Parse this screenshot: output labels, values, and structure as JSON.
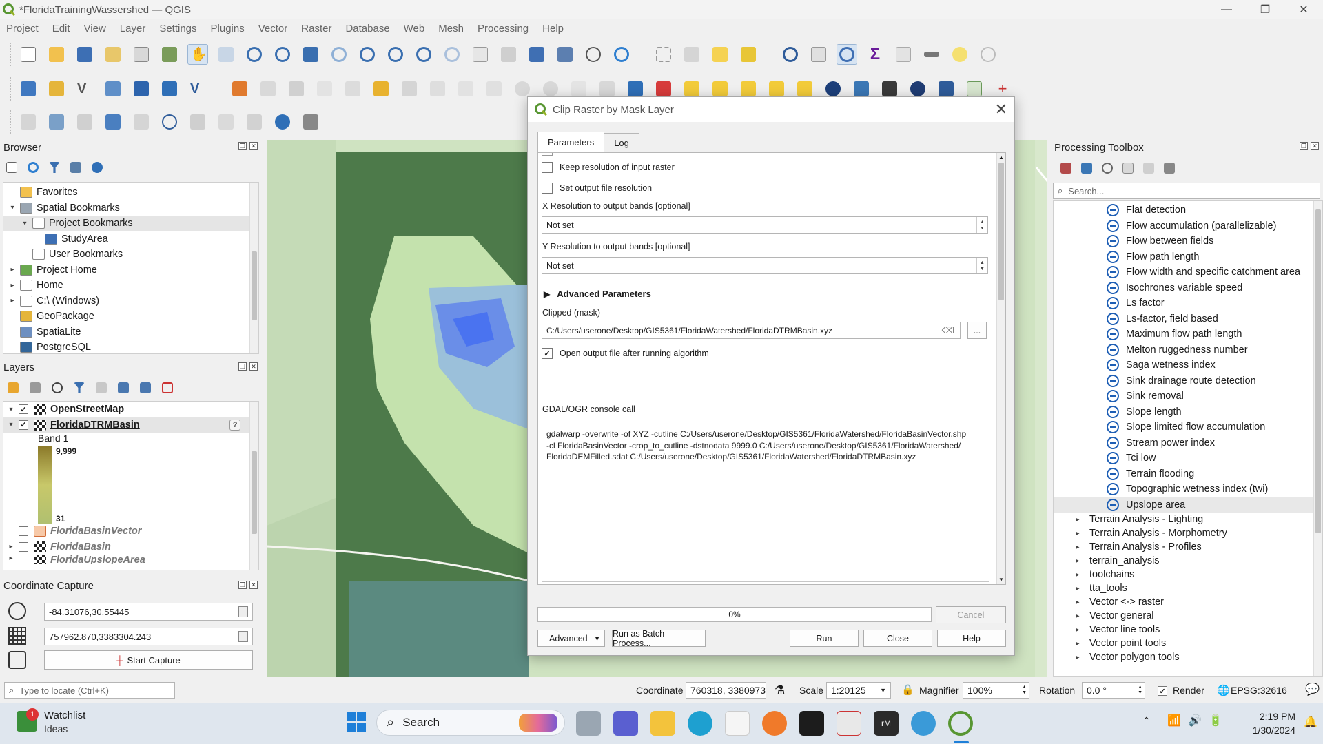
{
  "window": {
    "title": "*FloridaTrainingWassershed — QGIS"
  },
  "menu": [
    "Project",
    "Edit",
    "View",
    "Layer",
    "Settings",
    "Plugins",
    "Vector",
    "Raster",
    "Database",
    "Web",
    "Mesh",
    "Processing",
    "Help"
  ],
  "browser": {
    "title": "Browser",
    "items": [
      {
        "label": "Favorites",
        "depth": 0,
        "arrow": ""
      },
      {
        "label": "Spatial Bookmarks",
        "depth": 0,
        "arrow": "▾"
      },
      {
        "label": "Project Bookmarks",
        "depth": 1,
        "arrow": "▾"
      },
      {
        "label": "StudyArea",
        "depth": 2,
        "arrow": ""
      },
      {
        "label": "User Bookmarks",
        "depth": 1,
        "arrow": ""
      },
      {
        "label": "Project Home",
        "depth": 0,
        "arrow": "▸"
      },
      {
        "label": "Home",
        "depth": 0,
        "arrow": "▸"
      },
      {
        "label": "C:\\ (Windows)",
        "depth": 0,
        "arrow": "▸"
      },
      {
        "label": "GeoPackage",
        "depth": 0,
        "arrow": ""
      },
      {
        "label": "SpatiaLite",
        "depth": 0,
        "arrow": ""
      },
      {
        "label": "PostgreSQL",
        "depth": 0,
        "arrow": ""
      }
    ]
  },
  "layers": {
    "title": "Layers",
    "openstreetmap": "OpenStreetMap",
    "dtrm": "FloridaDTRMBasin",
    "band": "Band 1",
    "max": "9,999",
    "min": "31",
    "basin_vector": "FloridaBasinVector",
    "basin": "FloridaBasin",
    "upslope": "FloridaUpslopeArea"
  },
  "coordinate_capture": {
    "title": "Coordinate Capture",
    "geo": "-84.31076,30.55445",
    "proj": "757962.870,3383304.243",
    "start": "Start Capture"
  },
  "dialog": {
    "title": "Clip Raster by Mask Layer",
    "tab_parameters": "Parameters",
    "tab_log": "Log",
    "keep_resolution": "Keep resolution of input raster",
    "set_resolution": "Set output file resolution",
    "x_res_label": "X Resolution to output bands [optional]",
    "x_res_value": "Not set",
    "y_res_label": "Y Resolution to output bands [optional]",
    "y_res_value": "Not set",
    "advanced_params": "Advanced Parameters",
    "clipped_label": "Clipped (mask)",
    "clipped_path": "C:/Users/userone/Desktop/GIS5361/FloridaWatershed/FloridaDTRMBasin.xyz",
    "browse": "...",
    "open_output": "Open output file after running algorithm",
    "console_label": "GDAL/OGR console call",
    "console_lines": [
      "gdalwarp -overwrite -of XYZ -cutline C:/Users/userone/Desktop/GIS5361/FloridaWatershed/FloridaBasinVector.shp",
      "-cl FloridaBasinVector -crop_to_cutline -dstnodata 9999.0 C:/Users/userone/Desktop/GIS5361/FloridaWatershed/",
      "FloridaDEMFilled.sdat C:/Users/userone/Desktop/GIS5361/FloridaWatershed/FloridaDTRMBasin.xyz"
    ],
    "progress": "0%",
    "progress_value": 0,
    "cancel": "Cancel",
    "advanced": "Advanced",
    "batch": "Run as Batch Process...",
    "run": "Run",
    "close": "Close",
    "help": "Help"
  },
  "toolbox": {
    "title": "Processing Toolbox",
    "search_placeholder": "Search...",
    "algorithms": [
      "Flat detection",
      "Flow accumulation (parallelizable)",
      "Flow between fields",
      "Flow path length",
      "Flow width and specific catchment area",
      "Isochrones variable speed",
      "Ls factor",
      "Ls-factor, field based",
      "Maximum flow path length",
      "Melton ruggedness number",
      "Saga wetness index",
      "Sink drainage route detection",
      "Sink removal",
      "Slope length",
      "Slope limited flow accumulation",
      "Stream power index",
      "Tci low",
      "Terrain flooding",
      "Topographic wetness index (twi)",
      "Upslope area"
    ],
    "groups": [
      "Terrain Analysis - Lighting",
      "Terrain Analysis - Morphometry",
      "Terrain Analysis - Profiles",
      "terrain_analysis",
      "toolchains",
      "tta_tools",
      "Vector <-> raster",
      "Vector general",
      "Vector line tools",
      "Vector point tools",
      "Vector polygon tools"
    ]
  },
  "statusbar": {
    "locate_placeholder": "Type to locate (Ctrl+K)",
    "coordinate_label": "Coordinate",
    "coordinate": "760318, 3380973",
    "scale_label": "Scale",
    "scale": "1:20125",
    "magnifier_label": "Magnifier",
    "magnifier": "100%",
    "rotation_label": "Rotation",
    "rotation": "0.0 °",
    "render": "Render",
    "crs": "EPSG:32616"
  },
  "taskbar": {
    "widget_title": "Watchlist",
    "widget_sub": "Ideas",
    "badge": "1",
    "search": "Search",
    "time": "2:19 PM",
    "date": "1/30/2024"
  }
}
